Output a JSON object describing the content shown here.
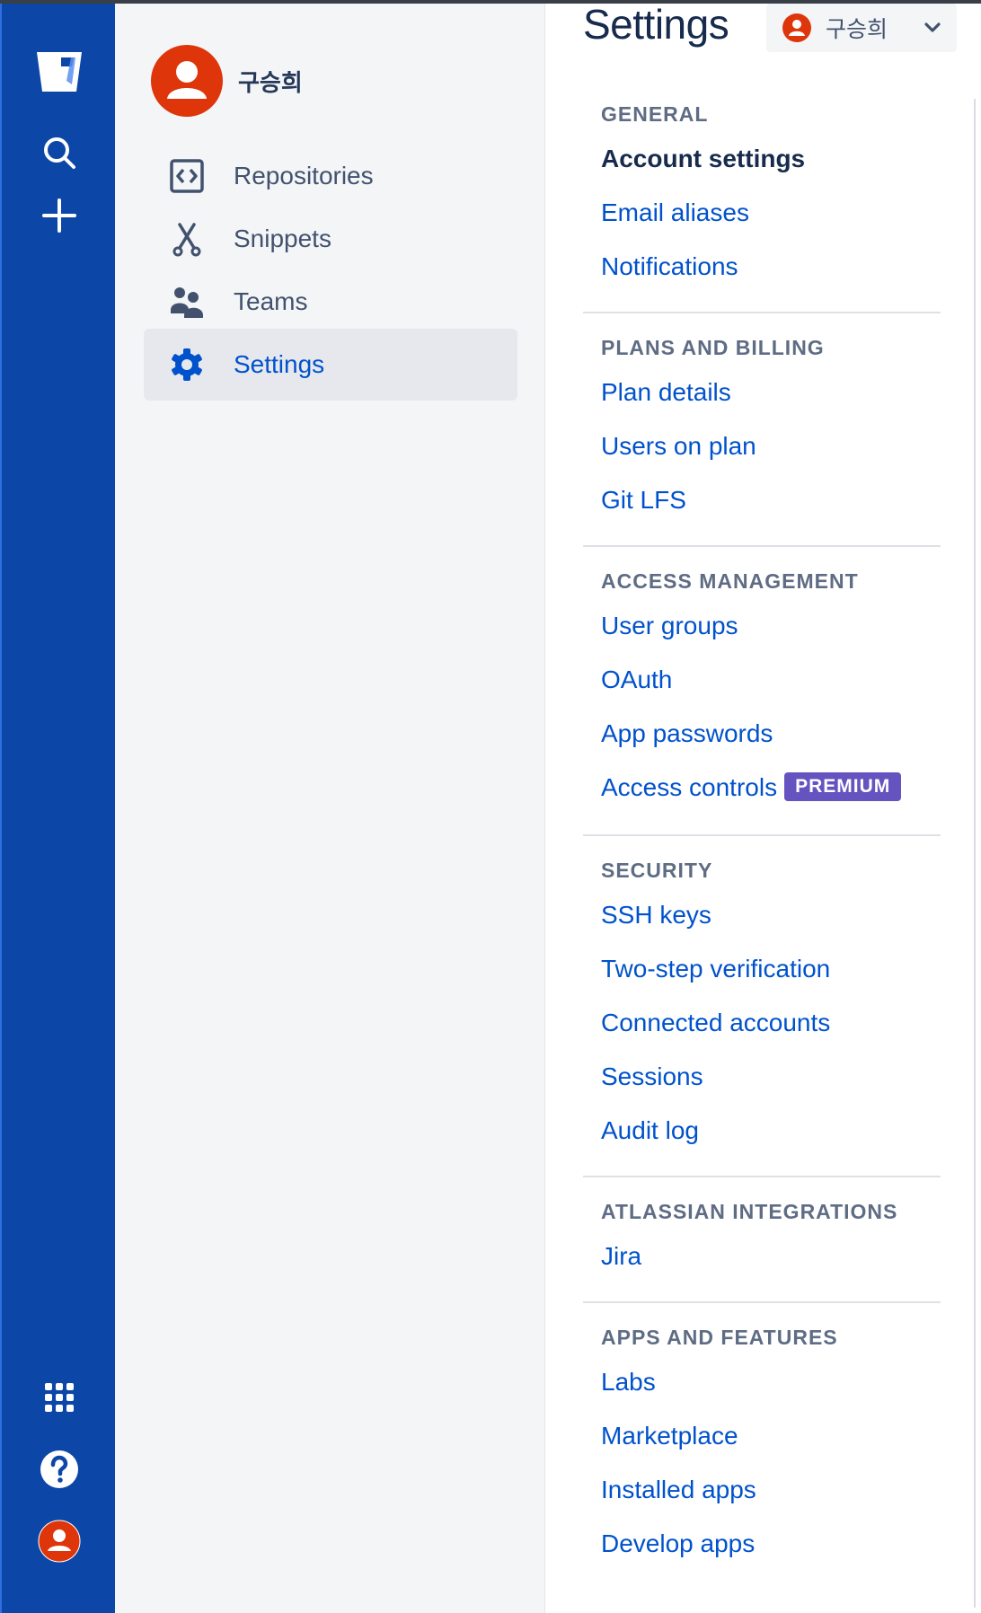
{
  "user": {
    "name": "구승희"
  },
  "sidebar": {
    "items": [
      {
        "label": "Repositories",
        "icon": "code-brackets-icon"
      },
      {
        "label": "Snippets",
        "icon": "scissors-icon"
      },
      {
        "label": "Teams",
        "icon": "people-icon"
      },
      {
        "label": "Settings",
        "icon": "gear-icon",
        "selected": true
      }
    ]
  },
  "global_nav": {
    "top_icons": [
      "bitbucket-logo",
      "search-icon",
      "plus-icon"
    ],
    "bottom_icons": [
      "app-switcher-icon",
      "help-icon",
      "user-avatar"
    ]
  },
  "settings": {
    "title": "Settings",
    "account_switcher": {
      "name": "구승희"
    },
    "sections": [
      {
        "heading": "GENERAL",
        "links": [
          {
            "label": "Account settings",
            "current": true
          },
          {
            "label": "Email aliases"
          },
          {
            "label": "Notifications"
          }
        ]
      },
      {
        "heading": "PLANS AND BILLING",
        "links": [
          {
            "label": "Plan details"
          },
          {
            "label": "Users on plan"
          },
          {
            "label": "Git LFS"
          }
        ]
      },
      {
        "heading": "ACCESS MANAGEMENT",
        "links": [
          {
            "label": "User groups"
          },
          {
            "label": "OAuth"
          },
          {
            "label": "App passwords"
          },
          {
            "label": "Access controls",
            "badge": "PREMIUM"
          }
        ]
      },
      {
        "heading": "SECURITY",
        "links": [
          {
            "label": "SSH keys"
          },
          {
            "label": "Two-step verification"
          },
          {
            "label": "Connected accounts"
          },
          {
            "label": "Sessions"
          },
          {
            "label": "Audit log"
          }
        ]
      },
      {
        "heading": "ATLASSIAN INTEGRATIONS",
        "links": [
          {
            "label": "Jira"
          }
        ]
      },
      {
        "heading": "APPS AND FEATURES",
        "links": [
          {
            "label": "Labs"
          },
          {
            "label": "Marketplace"
          },
          {
            "label": "Installed apps"
          },
          {
            "label": "Develop apps"
          }
        ]
      }
    ]
  },
  "colors": {
    "global_nav_bg": "#0c47a8",
    "sidebar_bg": "#f4f5f7",
    "link": "#0052cc",
    "avatar": "#de350b",
    "premium_badge": "#6554c0"
  }
}
